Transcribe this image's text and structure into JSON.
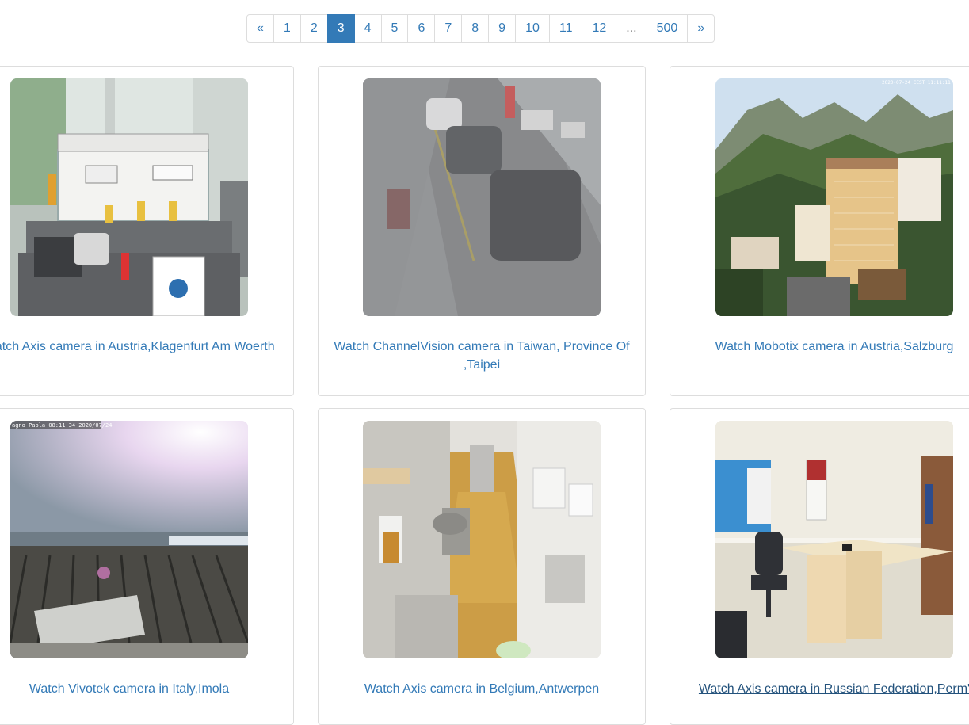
{
  "pagination": {
    "prev": "«",
    "next": "»",
    "pages": [
      "1",
      "2",
      "3",
      "4",
      "5",
      "6",
      "7",
      "8",
      "9",
      "10",
      "11",
      "12",
      "...",
      "500"
    ],
    "active": "3"
  },
  "cameras": [
    {
      "caption": "Watch Axis camera in Austria,Klagenfurt Am Woerth"
    },
    {
      "caption": "Watch ChannelVision camera in Taiwan, Province Of ,Taipei"
    },
    {
      "caption": "Watch Mobotix camera in Austria,Salzburg"
    },
    {
      "caption": "Watch Vivotek camera in Italy,Imola"
    },
    {
      "caption": "Watch Axis camera in Belgium,Antwerpen"
    },
    {
      "caption": "Watch Axis camera in Russian Federation,Perm'"
    }
  ],
  "overlays": {
    "mobotix_stamp": "2020-07-24 CEST 11:11:11",
    "vivotek_stamp": "agno Paola 08:11:34 2020/07/24"
  },
  "colors": {
    "link": "#337ab7",
    "link_hover": "#23527c",
    "active_page": "#337ab7",
    "border": "#dddddd"
  }
}
